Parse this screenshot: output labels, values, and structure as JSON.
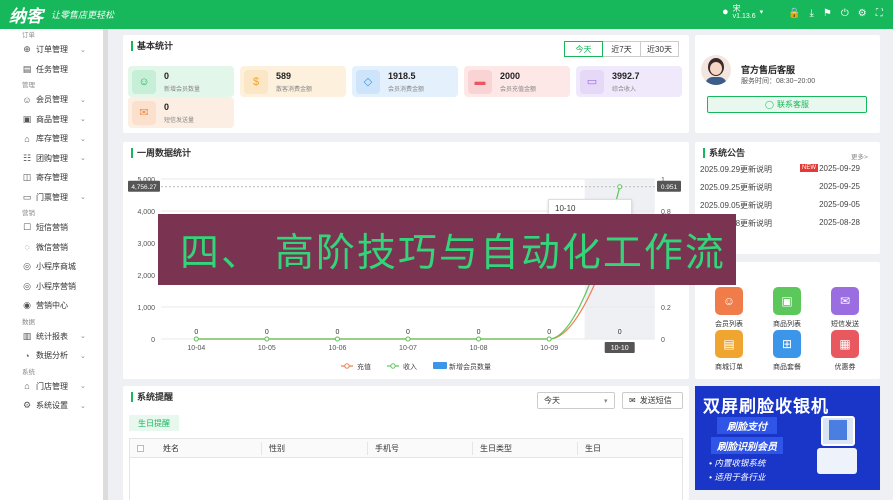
{
  "header": {
    "logo": "纳客",
    "slogan": "让零售店更轻松",
    "user_name": "宋",
    "version": "v1.13.6"
  },
  "sidebar": {
    "sections": [
      {
        "title": "订单",
        "items": [
          {
            "label": "订单管理",
            "icon": "globe-icon",
            "chevron": true
          },
          {
            "label": "任务管理",
            "icon": "clipboard-icon",
            "chevron": false
          }
        ]
      },
      {
        "title": "管理",
        "items": [
          {
            "label": "会员管理",
            "icon": "user-icon",
            "chevron": true
          },
          {
            "label": "商品管理",
            "icon": "box-icon",
            "chevron": true
          },
          {
            "label": "库存管理",
            "icon": "warehouse-icon",
            "chevron": true
          },
          {
            "label": "团购管理",
            "icon": "group-icon",
            "chevron": true
          },
          {
            "label": "寄存管理",
            "icon": "storage-icon",
            "chevron": false
          },
          {
            "label": "门票管理",
            "icon": "ticket-icon",
            "chevron": true
          }
        ]
      },
      {
        "title": "营销",
        "items": [
          {
            "label": "短信营销",
            "icon": "sms-icon",
            "chevron": false
          },
          {
            "label": "微信营销",
            "icon": "wechat-icon",
            "chevron": false
          },
          {
            "label": "小程序商城",
            "icon": "miniapp-icon",
            "chevron": false
          },
          {
            "label": "小程序营销",
            "icon": "miniapp-marketing-icon",
            "chevron": false
          },
          {
            "label": "营销中心",
            "icon": "target-icon",
            "chevron": false
          }
        ]
      },
      {
        "title": "数据",
        "items": [
          {
            "label": "统计报表",
            "icon": "report-icon",
            "chevron": true
          },
          {
            "label": "数据分析",
            "icon": "analysis-icon",
            "chevron": true
          }
        ]
      },
      {
        "title": "系统",
        "items": [
          {
            "label": "门店管理",
            "icon": "store-icon",
            "chevron": true
          },
          {
            "label": "系统设置",
            "icon": "settings-icon",
            "chevron": true
          }
        ]
      }
    ]
  },
  "basic_stats": {
    "title": "基本统计",
    "tabs": [
      "今天",
      "近7天",
      "近30天"
    ],
    "active_tab": "今天",
    "cards": [
      {
        "value": "0",
        "label": "新增会员数量",
        "icon": "member-icon",
        "bg": "#e3f6ea",
        "fg": "#16b85b"
      },
      {
        "value": "589",
        "label": "散客消费金额",
        "icon": "coin-icon",
        "bg": "#fdf1dd",
        "fg": "#f0a531"
      },
      {
        "value": "1918.5",
        "label": "会员消费金额",
        "icon": "diamond-icon",
        "bg": "#e4f1fd",
        "fg": "#3b95e8"
      },
      {
        "value": "2000",
        "label": "会员充值金额",
        "icon": "card-icon",
        "bg": "#fde7e7",
        "fg": "#e8585e"
      },
      {
        "value": "3992.7",
        "label": "综合收入",
        "icon": "wallet-icon",
        "bg": "#f0e9fb",
        "fg": "#9a6de0"
      },
      {
        "value": "0",
        "label": "短信发送量",
        "icon": "mail-icon",
        "bg": "#fdeee3",
        "fg": "#f08a4b"
      }
    ]
  },
  "support": {
    "title": "官方售后客服",
    "hours": "服务时间：08:30~20:00",
    "button": "联系客服"
  },
  "announcements": {
    "title": "系统公告",
    "more": "更多>",
    "new_badge": "NEW",
    "items": [
      {
        "text": "2025.09.29更新说明",
        "date": "2025-09-29"
      },
      {
        "text": "2025.09.25更新说明",
        "date": "2025-09-25"
      },
      {
        "text": "2025.09.05更新说明",
        "date": "2025-09-05"
      },
      {
        "text": "2025.08.28更新说明",
        "date": "2025-08-28"
      }
    ]
  },
  "weekly": {
    "title": "一周数据统计",
    "tooltip_label": "10-10",
    "left_cursor": "4,756.27",
    "right_cursor": "0.951",
    "x_highlight": "10-10"
  },
  "chart_data": {
    "type": "line",
    "categories": [
      "10-04",
      "10-05",
      "10-06",
      "10-07",
      "10-08",
      "10-09",
      "10-10"
    ],
    "series": [
      {
        "name": "充值",
        "values": [
          0,
          0,
          0,
          0,
          0,
          0,
          3992.7
        ],
        "color": "#f07c4a"
      },
      {
        "name": "收入",
        "values": [
          0,
          0,
          0,
          0,
          0,
          0,
          4756.27
        ],
        "color": "#5cc85c"
      },
      {
        "name": "新增会员数量",
        "values": [
          0,
          0,
          0,
          0,
          0,
          0,
          0
        ],
        "color": "#3b95e8"
      }
    ],
    "data_labels": [
      "0",
      "0",
      "0",
      "0",
      "0",
      "0",
      "0"
    ],
    "y_ticks": [
      "0",
      "1,000",
      "2,000",
      "3,000",
      "4,000",
      "5,000"
    ],
    "ylim": [
      0,
      5000
    ],
    "y2_ticks": [
      "0",
      "0.2",
      "0.4",
      "0.6",
      "0.8",
      "1"
    ],
    "y2lim": [
      0,
      1
    ],
    "grid": true,
    "legend": "bottom"
  },
  "quick": {
    "items": [
      {
        "label": "会员列表",
        "icon": "member-list-icon",
        "color": "#f07c4a"
      },
      {
        "label": "商品列表",
        "icon": "shopping-bag-icon",
        "color": "#5cc85c"
      },
      {
        "label": "短信发送",
        "icon": "sms-send-icon",
        "color": "#9a6de0"
      },
      {
        "label": "商城订单",
        "icon": "order-icon",
        "color": "#f0a531"
      },
      {
        "label": "商品套餐",
        "icon": "basket-icon",
        "color": "#3b95e8"
      },
      {
        "label": "优惠券",
        "icon": "coupon-icon",
        "color": "#e8585e"
      }
    ]
  },
  "reminders": {
    "title": "系统提醒",
    "select_value": "今天",
    "sms_button": "发送短信",
    "tab": "生日提醒",
    "columns": [
      "姓名",
      "性别",
      "手机号",
      "生日类型",
      "生日"
    ]
  },
  "banner": {
    "title": "双屏刷脸收银机",
    "line1": "刷脸支付",
    "line2": "刷脸识别会员",
    "bullet1": "内置收银系统",
    "bullet2": "适用于各行业"
  },
  "overlay": {
    "text": "四、 高阶技巧与自动化工作流"
  }
}
